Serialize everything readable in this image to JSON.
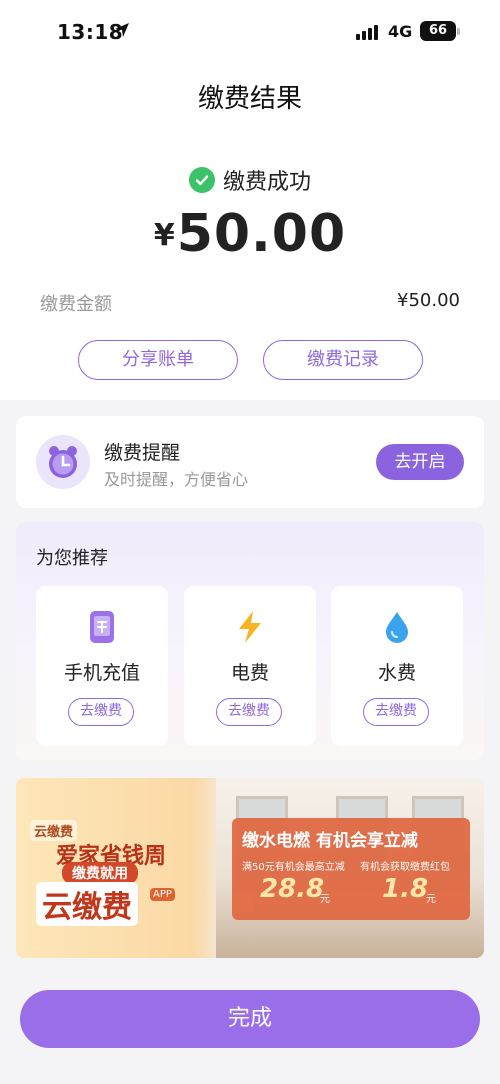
{
  "status_bar": {
    "time": "13:18",
    "network": "4G",
    "battery": "66"
  },
  "header": {
    "title": "缴费结果"
  },
  "result": {
    "status_text": "缴费成功",
    "currency_symbol": "¥",
    "amount": "50.00",
    "fee_label": "缴费金额",
    "fee_value": "¥50.00",
    "share_button": "分享账单",
    "records_button": "缴费记录"
  },
  "reminder": {
    "title": "缴费提醒",
    "subtitle": "及时提醒，方便省心",
    "button": "去开启"
  },
  "recommend": {
    "title": "为您推荐",
    "items": [
      {
        "name": "手机充值",
        "button": "去缴费",
        "icon": "phone-recharge-icon"
      },
      {
        "name": "电费",
        "button": "去缴费",
        "icon": "lightning-icon"
      },
      {
        "name": "水费",
        "button": "去缴费",
        "icon": "water-drop-icon"
      }
    ]
  },
  "banner": {
    "tag": "云缴费",
    "title1": "爱家省钱周",
    "title2": "缴费就用",
    "brand": "云缴费",
    "app_badge": "APP",
    "promo_title": "缴水电燃 有机会享立减",
    "offer1_label": "满50元有机会最高立减",
    "offer1_value": "28.8",
    "offer1_unit": "元",
    "offer2_label": "有机会获取缴费红包",
    "offer2_value": "1.8",
    "offer2_unit": "元"
  },
  "footer": {
    "done_button": "完成"
  },
  "colors": {
    "accent": "#8c63df",
    "success": "#3cc268"
  }
}
